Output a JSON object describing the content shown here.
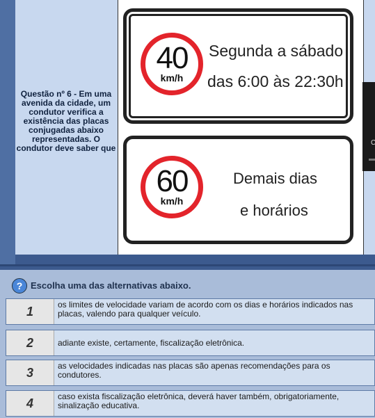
{
  "question": {
    "text": "Questão nº 6 - Em uma avenida da cidade, um condutor verifica a existência das placas conjugadas abaixo representadas. O condutor deve saber que"
  },
  "signs": [
    {
      "speed": "40",
      "unit": "km/h",
      "line1": "Segunda a sábado",
      "line2": "das 6:00 às 22:30h"
    },
    {
      "speed": "60",
      "unit": "km/h",
      "line1": "Demais dias",
      "line2": "e horários"
    }
  ],
  "thumbnail": {
    "char": "C"
  },
  "instructions": {
    "icon": "?",
    "text": "Escolha uma das alternativas abaixo."
  },
  "options": [
    {
      "num": "1",
      "text": "os limites de velocidade variam de acordo com os dias e horários indicados nas placas, valendo para qualquer veículo."
    },
    {
      "num": "2",
      "text": "adiante existe, certamente, fiscalização eletrônica."
    },
    {
      "num": "3",
      "text": "as velocidades indicadas nas placas são apenas recomendações para os condutores."
    },
    {
      "num": "4",
      "text": "caso exista fiscalização eletrônica, deverá haver também, obrigatoriamente, sinalização educativa."
    }
  ],
  "colors": {
    "background": "#3c5a8e",
    "sign_red": "#e3242b",
    "option_bg": "#d2dff0"
  }
}
